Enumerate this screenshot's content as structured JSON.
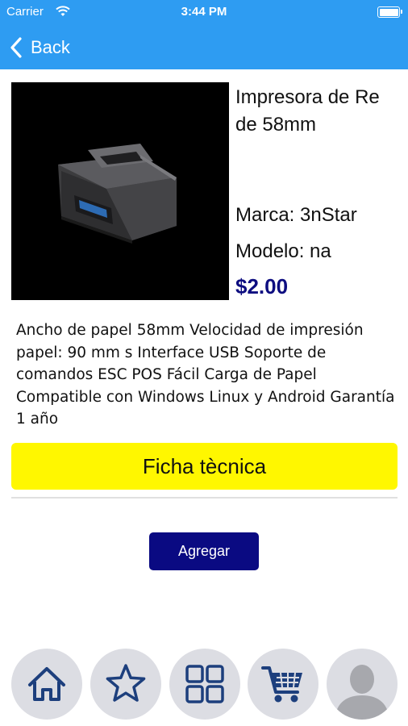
{
  "status_bar": {
    "carrier": "Carrier",
    "time": "3:44 PM"
  },
  "nav": {
    "back_label": "Back"
  },
  "product": {
    "title_line1": "Impresora de Re",
    "title_line2": "de 58mm",
    "brand": "Marca: 3nStar",
    "model": "Modelo: na",
    "price": "$2.00",
    "description": "Ancho de papel 58mm Velocidad de impresión  papel: 90 mm s Interface USB Soporte de comandos ESC POS Fácil Carga de Papel Compatible con Windows Linux y Android Garantía 1 año"
  },
  "actions": {
    "spec_label": "Ficha tècnica",
    "add_label": "Agregar"
  },
  "tabbar": {
    "items": [
      {
        "icon": "home-icon"
      },
      {
        "icon": "star-icon"
      },
      {
        "icon": "grid-icon"
      },
      {
        "icon": "cart-icon"
      },
      {
        "icon": "profile-icon"
      }
    ]
  },
  "colors": {
    "nav_blue": "#2e9cf2",
    "price": "#0d0d80",
    "spec_button": "#fff700",
    "add_button": "#0a0a82",
    "tab_circle": "#dcdde3",
    "tab_icon": "#1d3f7d"
  }
}
